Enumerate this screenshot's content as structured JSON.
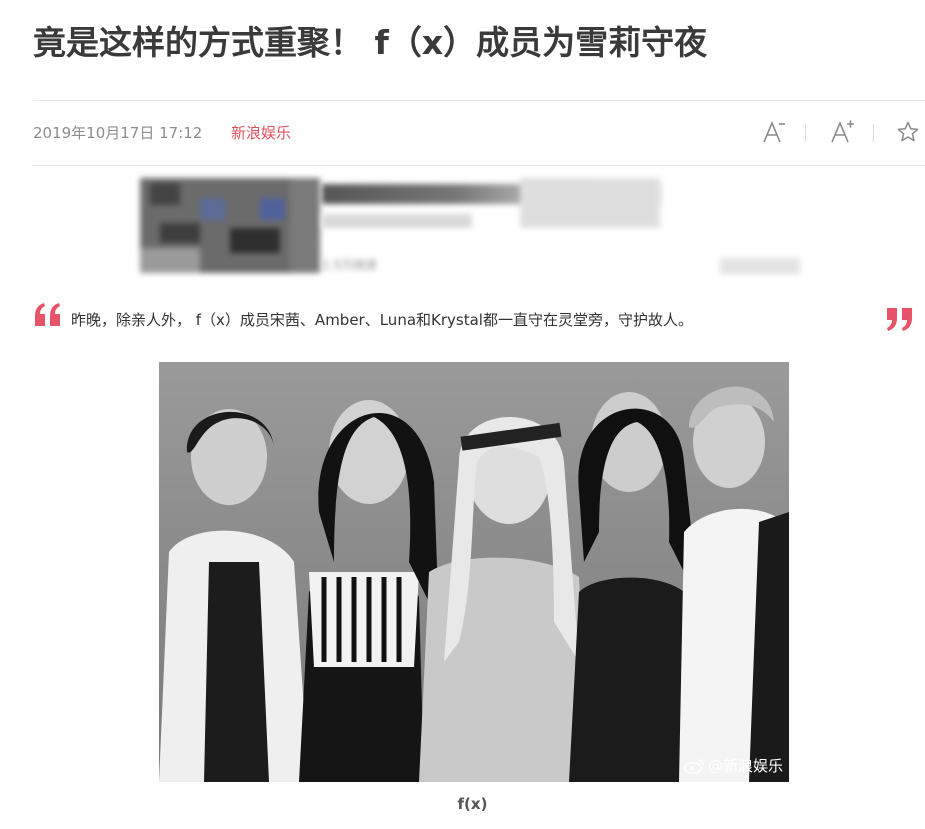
{
  "article": {
    "title": "竟是这样的方式重聚！ f（x）成员为雪莉守夜",
    "date": "2019年10月17日 17:12",
    "source": "新浪娱乐",
    "lead": "昨晚，除亲人外， f（x）成员宋茜、Amber、Luna和Krystal都一直守在灵堂旁，守护故人。",
    "photo_caption": "f(x)",
    "photo_watermark": "@新浪娱乐"
  },
  "toolbar": {
    "decrease_font_icon": "font-decrease-icon",
    "increase_font_icon": "font-increase-icon",
    "favorite_icon": "star-icon"
  },
  "blurred_card": {
    "title_fragment": "新款   索菲斯56 ",
    "read_count": "1.5万阅读"
  },
  "colors": {
    "accent": "#e0505f",
    "quote": "#e9536a",
    "text": "#333333",
    "muted": "#8d8d8d"
  }
}
